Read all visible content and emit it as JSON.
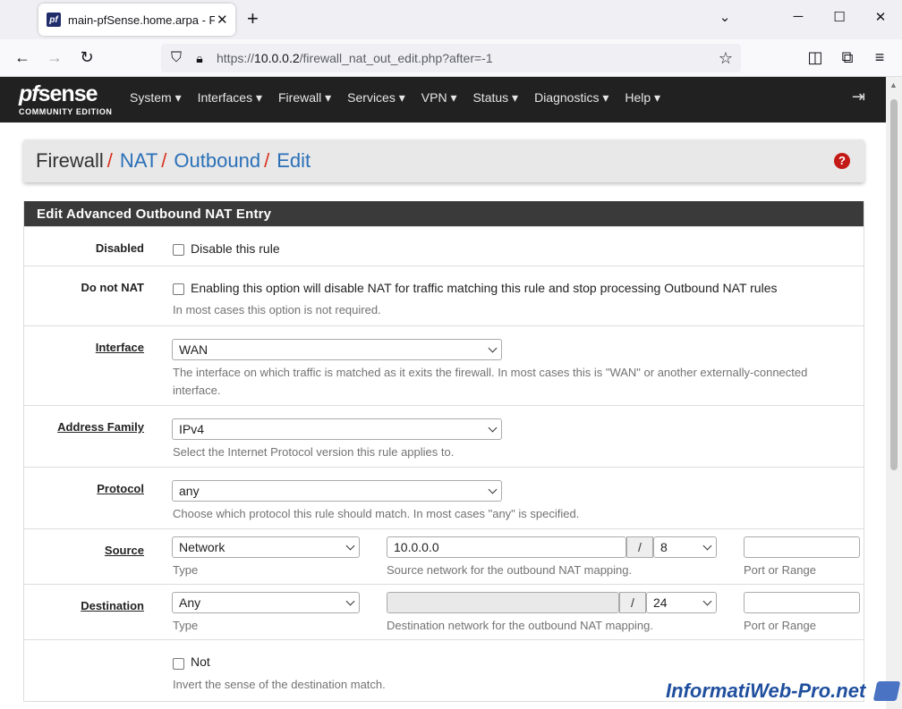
{
  "browser": {
    "tab_title": "main-pfSense.home.arpa - Fire",
    "tab_close": "✕",
    "new_tab": "+",
    "url_prefix": "https://",
    "url_host": "10.0.0.2",
    "url_path": "/firewall_nat_out_edit.php?after=-1"
  },
  "header": {
    "logo_pf": "pf",
    "logo_sense": "sense",
    "logo_sub": "COMMUNITY EDITION",
    "menu": [
      "System ▾",
      "Interfaces ▾",
      "Firewall ▾",
      "Services ▾",
      "VPN ▾",
      "Status ▾",
      "Diagnostics ▾",
      "Help ▾"
    ]
  },
  "breadcrumb": {
    "root": "Firewall",
    "items": [
      "NAT",
      "Outbound",
      "Edit"
    ],
    "separator": "/"
  },
  "panel": {
    "title": "Edit Advanced Outbound NAT Entry",
    "disabled": {
      "label": "Disabled",
      "checkbox_text": "Disable this rule"
    },
    "donotnat": {
      "label": "Do not NAT",
      "checkbox_text": "Enabling this option will disable NAT for traffic matching this rule and stop processing Outbound NAT rules",
      "hint": "In most cases this option is not required."
    },
    "interface": {
      "label": "Interface",
      "value": "WAN",
      "hint_line1": "The interface on which traffic is matched as it exits the firewall. In most cases this is \"WAN\" or another externally-connected",
      "hint_line2": "interface."
    },
    "address_family": {
      "label": "Address Family",
      "value": "IPv4",
      "hint": "Select the Internet Protocol version this rule applies to."
    },
    "protocol": {
      "label": "Protocol",
      "value": "any",
      "hint": "Choose which protocol this rule should match. In most cases \"any\" is specified."
    },
    "source": {
      "label": "Source",
      "type_value": "Network",
      "type_hint": "Type",
      "network": "10.0.0.0",
      "slash": "/",
      "mask": "8",
      "network_hint": "Source network for the outbound NAT mapping.",
      "port_hint": "Port or Range"
    },
    "destination": {
      "label": "Destination",
      "type_value": "Any",
      "type_hint": "Type",
      "network": "",
      "slash": "/",
      "mask": "24",
      "network_hint": "Destination network for the outbound NAT mapping.",
      "port_hint": "Port or Range"
    },
    "not": {
      "checkbox_text": "Not",
      "hint": "Invert the sense of the destination match."
    }
  },
  "watermark": "InformatiWeb-Pro.net"
}
